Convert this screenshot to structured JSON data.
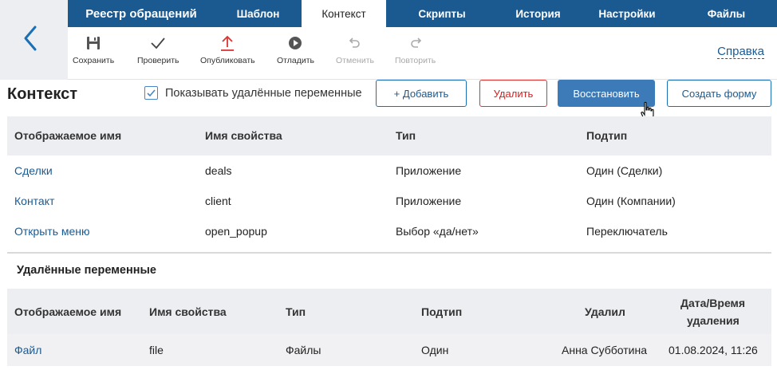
{
  "tabs": [
    {
      "label": "Реестр обращений"
    },
    {
      "label": "Шаблон"
    },
    {
      "label": "Контекст"
    },
    {
      "label": "Скрипты"
    },
    {
      "label": "История"
    },
    {
      "label": "Настройки"
    },
    {
      "label": "Файлы"
    }
  ],
  "toolbar": {
    "save": "Сохранить",
    "check": "Проверить",
    "publish": "Опубликовать",
    "debug": "Отладить",
    "undo": "Отменить",
    "redo": "Повторить",
    "help": "Справка"
  },
  "header": {
    "title": "Контекст",
    "show_deleted": "Показывать удалённые переменные",
    "add": "+ Добавить",
    "delete": "Удалить",
    "restore": "Восстановить",
    "create_form": "Создать форму"
  },
  "main_table": {
    "columns": [
      "Отображаемое имя",
      "Имя свойства",
      "Тип",
      "Подтип"
    ],
    "rows": [
      [
        "Сделки",
        "deals",
        "Приложение",
        "Один (Сделки)"
      ],
      [
        "Контакт",
        "client",
        "Приложение",
        "Один (Компании)"
      ],
      [
        "Открыть меню",
        "open_popup",
        "Выбор «да/нет»",
        "Переключатель"
      ]
    ]
  },
  "deleted": {
    "title": "Удалённые переменные",
    "columns": [
      "Отображаемое имя",
      "Имя свойства",
      "Тип",
      "Подтип",
      "Удалил",
      "Дата/Время",
      "удаления"
    ],
    "rows": [
      [
        "Файл",
        "file",
        "Файлы",
        "Один",
        "Анна Субботина",
        "01.08.2024, 11:26"
      ]
    ]
  },
  "colors": {
    "brand": "#1b5a91",
    "danger": "#d33333",
    "primary_button": "#3d7ab8"
  }
}
